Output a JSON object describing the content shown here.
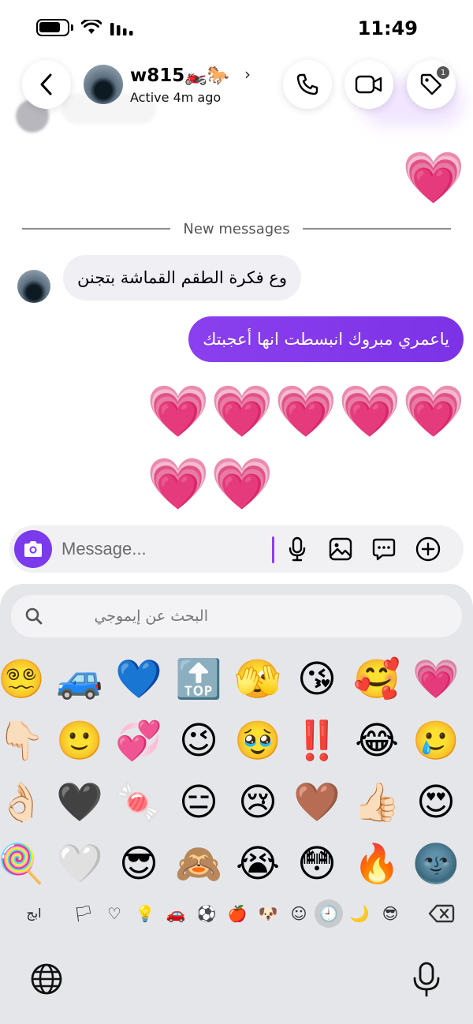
{
  "status": {
    "time": "11:49"
  },
  "header": {
    "name": "w815🏍️🐎",
    "status": "Active 4m ago",
    "badge": "1"
  },
  "divider": {
    "label": "New messages"
  },
  "messages": {
    "incoming": "وع فكرة الطقم القماشة بتجنن",
    "outgoing": "ياعمري مبروك انبسطت انها أعجبتك"
  },
  "hearts": {
    "emoji": "💗"
  },
  "composer": {
    "placeholder": "Message..."
  },
  "keyboard": {
    "search_placeholder": "البحث عن إيموجي",
    "abc_label": "ابج",
    "emojis": [
      [
        "😵‍💫",
        "🚙",
        "💙",
        "🔝",
        "🫣",
        "😘",
        "🥰",
        "💗"
      ],
      [
        "👇🏻",
        "🙂",
        "💞",
        "😉",
        "🥹",
        "‼️",
        "😂",
        "🥲"
      ],
      [
        "👌🏻",
        "🖤",
        "🍬",
        "😑",
        "😢",
        "🤎",
        "👍🏻",
        "😍"
      ],
      [
        "🍭",
        "🤍",
        "😎",
        "🙈",
        "😭",
        "😳",
        "🔥",
        "🌚"
      ]
    ],
    "categories": [
      "🏳",
      "♡",
      "💡",
      "🚗",
      "⚽",
      "🍎",
      "🐶",
      "☺",
      "🕘",
      "🌙",
      "😎"
    ]
  },
  "colors": {
    "accent": "#7C3AED",
    "keyboard_bg": "#E5E6EA",
    "incoming_bubble": "#EFEFF4"
  }
}
